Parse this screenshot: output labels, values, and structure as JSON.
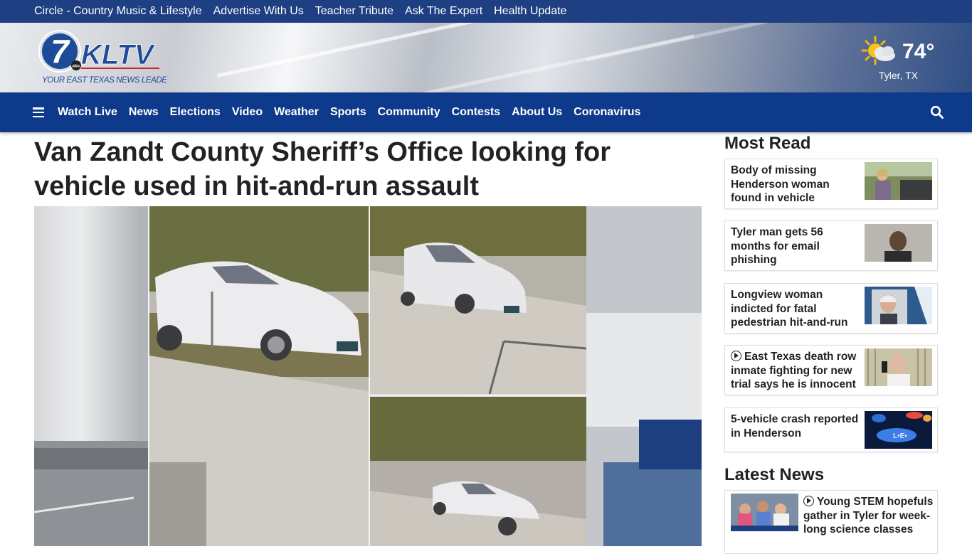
{
  "topbar": {
    "links": [
      "Circle - Country Music & Lifestyle",
      "Advertise With Us",
      "Teacher Tribute",
      "Ask The Expert",
      "Health Update"
    ]
  },
  "header": {
    "logo_number": "7",
    "logo_text": "KLTV",
    "logo_network": "abc",
    "tagline": "YOUR EAST TEXAS NEWS LEADER",
    "weather": {
      "temp": "74°",
      "location": "Tyler, TX",
      "icon": "partly-sunny-icon"
    }
  },
  "nav": {
    "items": [
      "Watch Live",
      "News",
      "Elections",
      "Video",
      "Weather",
      "Sports",
      "Community",
      "Contests",
      "About Us",
      "Coronavirus"
    ]
  },
  "article": {
    "headline": "Van Zandt County Sheriff’s Office looking for vehicle used in hit-and-run assault"
  },
  "most_read": {
    "title": "Most Read",
    "items": [
      {
        "title": "Body of missing Henderson woman found in vehicle",
        "video": false
      },
      {
        "title": "Tyler man gets 56 months for email phishing",
        "video": false
      },
      {
        "title": "Longview woman indicted for fatal pedestrian hit-and-run",
        "video": false
      },
      {
        "title": "East Texas death row inmate fighting for new trial says he is innocent",
        "video": true
      },
      {
        "title": "5-vehicle crash reported in Henderson",
        "video": false
      }
    ]
  },
  "latest_news": {
    "title": "Latest News",
    "items": [
      {
        "title": "Young STEM hopefuls gather in Tyler for week-long science classes",
        "video": true
      }
    ]
  },
  "colors": {
    "topbar": "#1e3f82",
    "nav": "#0e3a8c",
    "accent_blue": "#2a5aa8"
  }
}
